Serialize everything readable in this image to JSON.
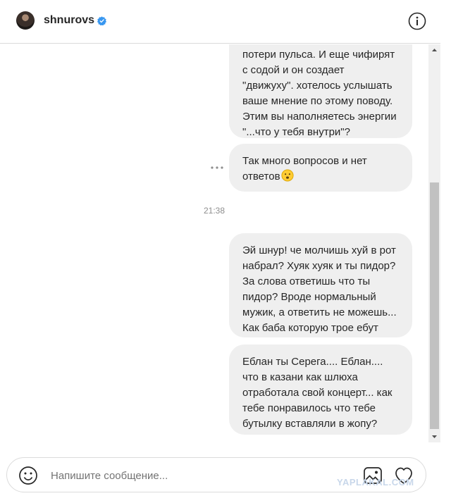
{
  "header": {
    "username": "shnurovs",
    "verified_icon": "verified-badge-icon",
    "info_icon": "info-icon"
  },
  "messages": [
    {
      "text": "потери пульса. И еще чифирят с содой и он создает \"движуху\". хотелось услышать ваше мнение по этому поводу. Этим вы наполняетесь энергии \"...что у тебя внутри\"?"
    },
    {
      "text": "Так много вопросов и нет ответов",
      "emoji": "neutral-face-emoji"
    },
    {
      "text": "Эй шнур! че молчишь хуй в рот набрал? Хуяк хуяк и ты пидор? За слова ответишь что ты пидор? Вроде нормальный мужик, а ответить не можешь... Как баба которую трое ебут"
    },
    {
      "text": "Еблан ты Серега.... Еблан.... что в казани как шлюха отработала свой концерт... как тебе понравилось что тебе бутылку вставляли в жопу?"
    }
  ],
  "timestamp": "21:38",
  "more_icon": "more-options-icon",
  "composer": {
    "placeholder": "Напишите сообщение...",
    "emoji_icon": "smile-icon",
    "image_icon": "image-icon",
    "like_icon": "heart-icon"
  },
  "watermark": "YAPLAKAL.COM"
}
